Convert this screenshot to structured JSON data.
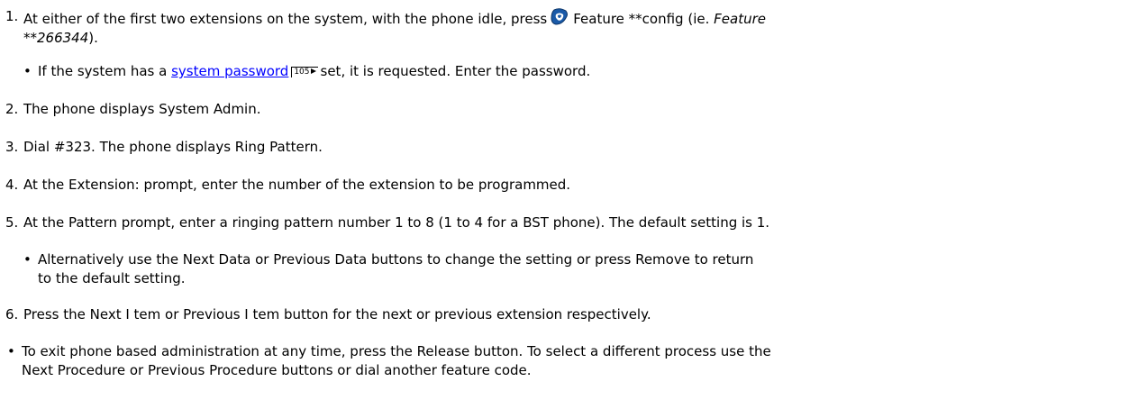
{
  "step1": {
    "num": "1.",
    "text_a": "At either of the first two extensions on the system, with the phone idle, press",
    "text_b": "Feature **config (ie.",
    "text_c": "Feature",
    "text_d": "**266344",
    "text_e": ").",
    "icon": "feature-key-icon"
  },
  "step1_bullet": {
    "text_a": "If the system has a",
    "link": "system password",
    "pageref": "105",
    "text_b": "set, it is requested. Enter the password."
  },
  "step2": {
    "num": "2.",
    "text": "The phone displays System Admin."
  },
  "step3": {
    "num": "3.",
    "text": "Dial #323. The phone displays Ring Pattern."
  },
  "step4": {
    "num": "4.",
    "text": "At the Extension: prompt, enter the number of the extension to be programmed."
  },
  "step5": {
    "num": "5.",
    "text": "At the Pattern prompt, enter a ringing pattern number 1 to 8 (1 to 4 for a BST phone). The default setting is 1."
  },
  "step5_bullet": {
    "line1": "Alternatively use the Next Data or Previous Data buttons to change the setting or press Remove to return",
    "line2": "to the default setting."
  },
  "step6": {
    "num": "6.",
    "text": "Press the Next I tem or Previous I tem button for the next or previous extension respectively."
  },
  "final_bullet": {
    "line1": "To exit phone based administration at any time, press the Release button. To select a different process use the",
    "line2": "Next Procedure or Previous Procedure buttons or dial another feature code."
  },
  "colors": {
    "link": "#0000ff",
    "icon_blue": "#1a5aa8"
  }
}
